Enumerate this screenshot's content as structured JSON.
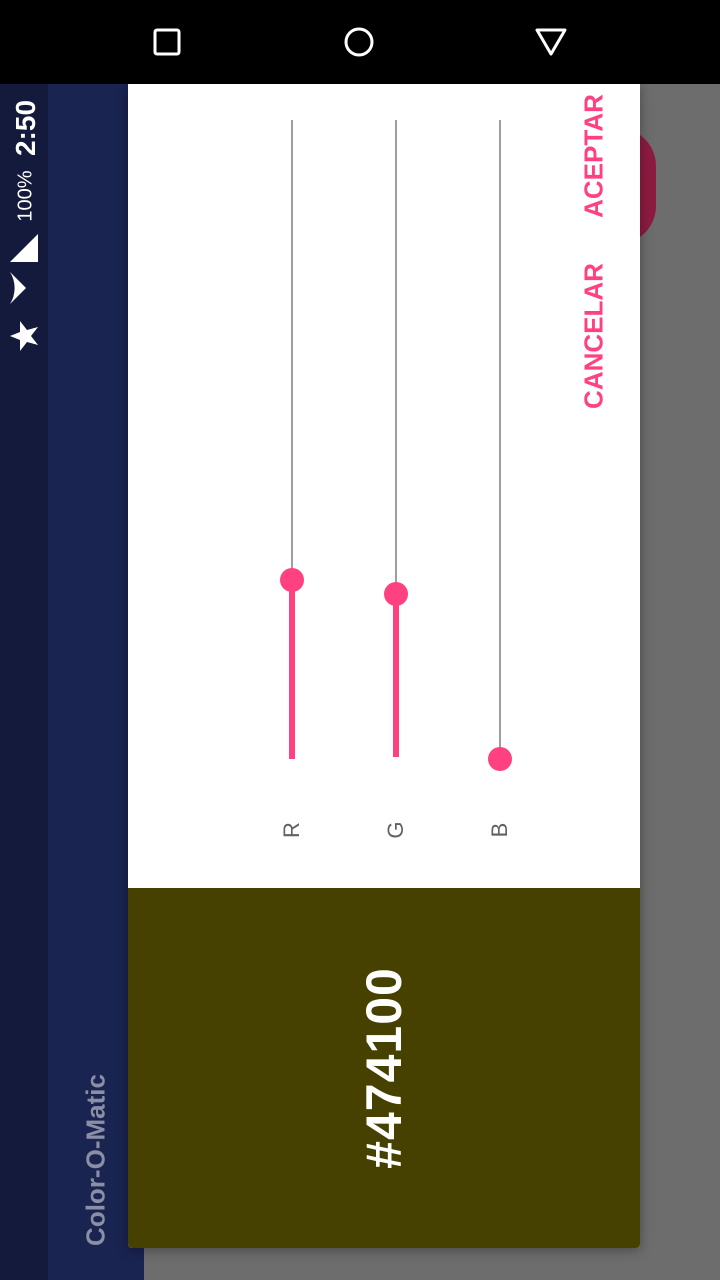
{
  "status_bar": {
    "time": "2:50",
    "battery": "100%"
  },
  "app": {
    "title": "Color-O-Matic"
  },
  "dialog": {
    "hex_value": "#474100",
    "swatch_color": "#474100",
    "accent_color": "#ff4081",
    "sliders": [
      {
        "label": "R",
        "value": 71,
        "max": 255
      },
      {
        "label": "G",
        "value": 65,
        "max": 255
      },
      {
        "label": "B",
        "value": 0,
        "max": 255
      }
    ],
    "cancel_label": "CANCELAR",
    "accept_label": "ACEPTAR"
  },
  "icons": {
    "nav": [
      "recents-square-icon",
      "home-circle-icon",
      "back-triangle-icon"
    ],
    "status": [
      "star-icon",
      "wifi-icon",
      "signal-icon"
    ]
  }
}
